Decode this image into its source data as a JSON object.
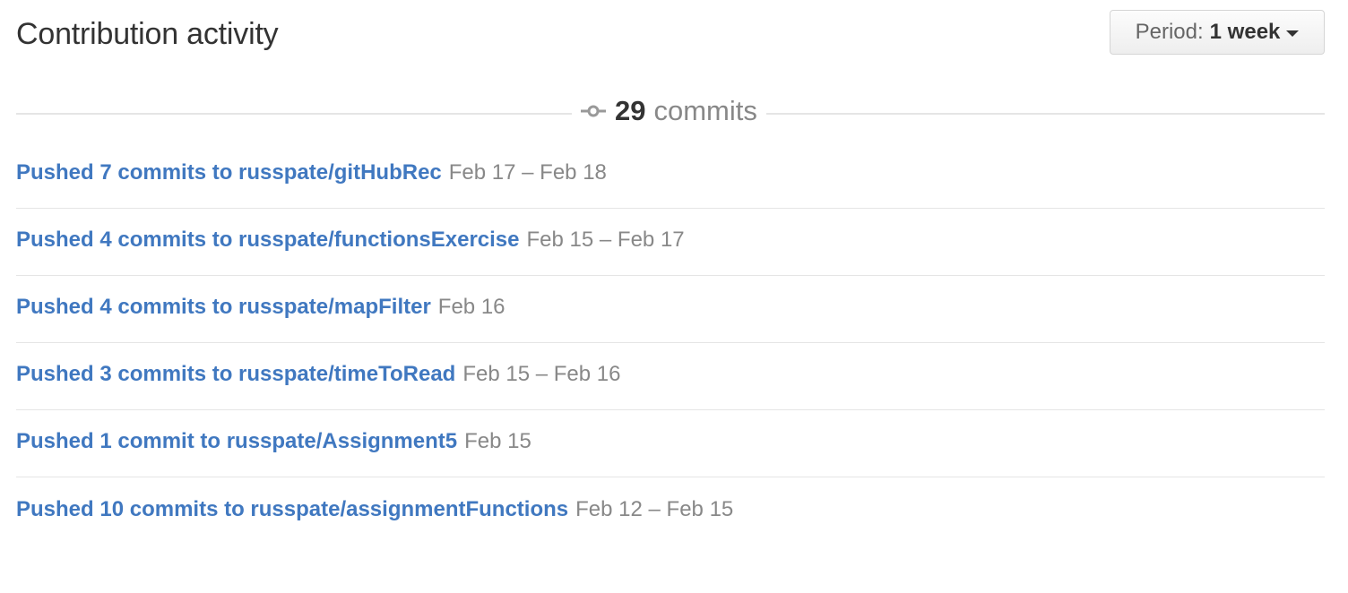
{
  "header": {
    "title": "Contribution activity",
    "period_prefix": "Period:",
    "period_value": "1 week"
  },
  "summary": {
    "icon": "git-commit-icon",
    "count": "29",
    "unit": "commits"
  },
  "activity": [
    {
      "text": "Pushed 7 commits to russpate/gitHubRec",
      "date": "Feb 17 – Feb 18"
    },
    {
      "text": "Pushed 4 commits to russpate/functionsExercise",
      "date": "Feb 15 – Feb 17"
    },
    {
      "text": "Pushed 4 commits to russpate/mapFilter",
      "date": "Feb 16"
    },
    {
      "text": "Pushed 3 commits to russpate/timeToRead",
      "date": "Feb 15 – Feb 16"
    },
    {
      "text": "Pushed 1 commit to russpate/Assignment5",
      "date": "Feb 15"
    },
    {
      "text": "Pushed 10 commits to russpate/assignmentFunctions",
      "date": "Feb 12 – Feb 15"
    }
  ],
  "colors": {
    "link": "#4078c0",
    "muted": "#888888",
    "text": "#333333",
    "divider": "#e5e5e5"
  }
}
